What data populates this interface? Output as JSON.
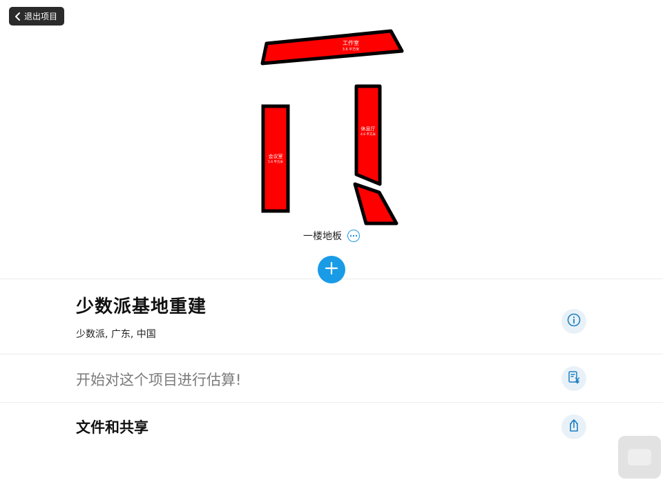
{
  "header": {
    "exit_label": "退出项目",
    "exit_icon": "chevron-left-icon"
  },
  "floorplan": {
    "rooms": [
      {
        "name": "工作室",
        "area": "3.6 平方米"
      },
      {
        "name": "会议室",
        "area": "5.6 平方米"
      },
      {
        "name": "休息厅",
        "area": "4.6 平方米"
      },
      {
        "name": "",
        "area": ""
      }
    ],
    "room_fill_color": "#ff0000",
    "room_stroke_color": "#000000"
  },
  "floor": {
    "label": "一楼地板",
    "more_icon": "ellipsis-circle-icon"
  },
  "add_button": {
    "icon": "plus-icon",
    "color": "#1a9be6"
  },
  "project": {
    "title": "少数派基地重建",
    "location": "少数派, 广东, 中国",
    "info_icon": "info-circle-icon"
  },
  "estimate": {
    "text": "开始对这个项目进行估算!",
    "icon": "invoice-yen-icon"
  },
  "share": {
    "text": "文件和共享",
    "icon": "share-icon"
  },
  "accent_color": "#1a9be6"
}
